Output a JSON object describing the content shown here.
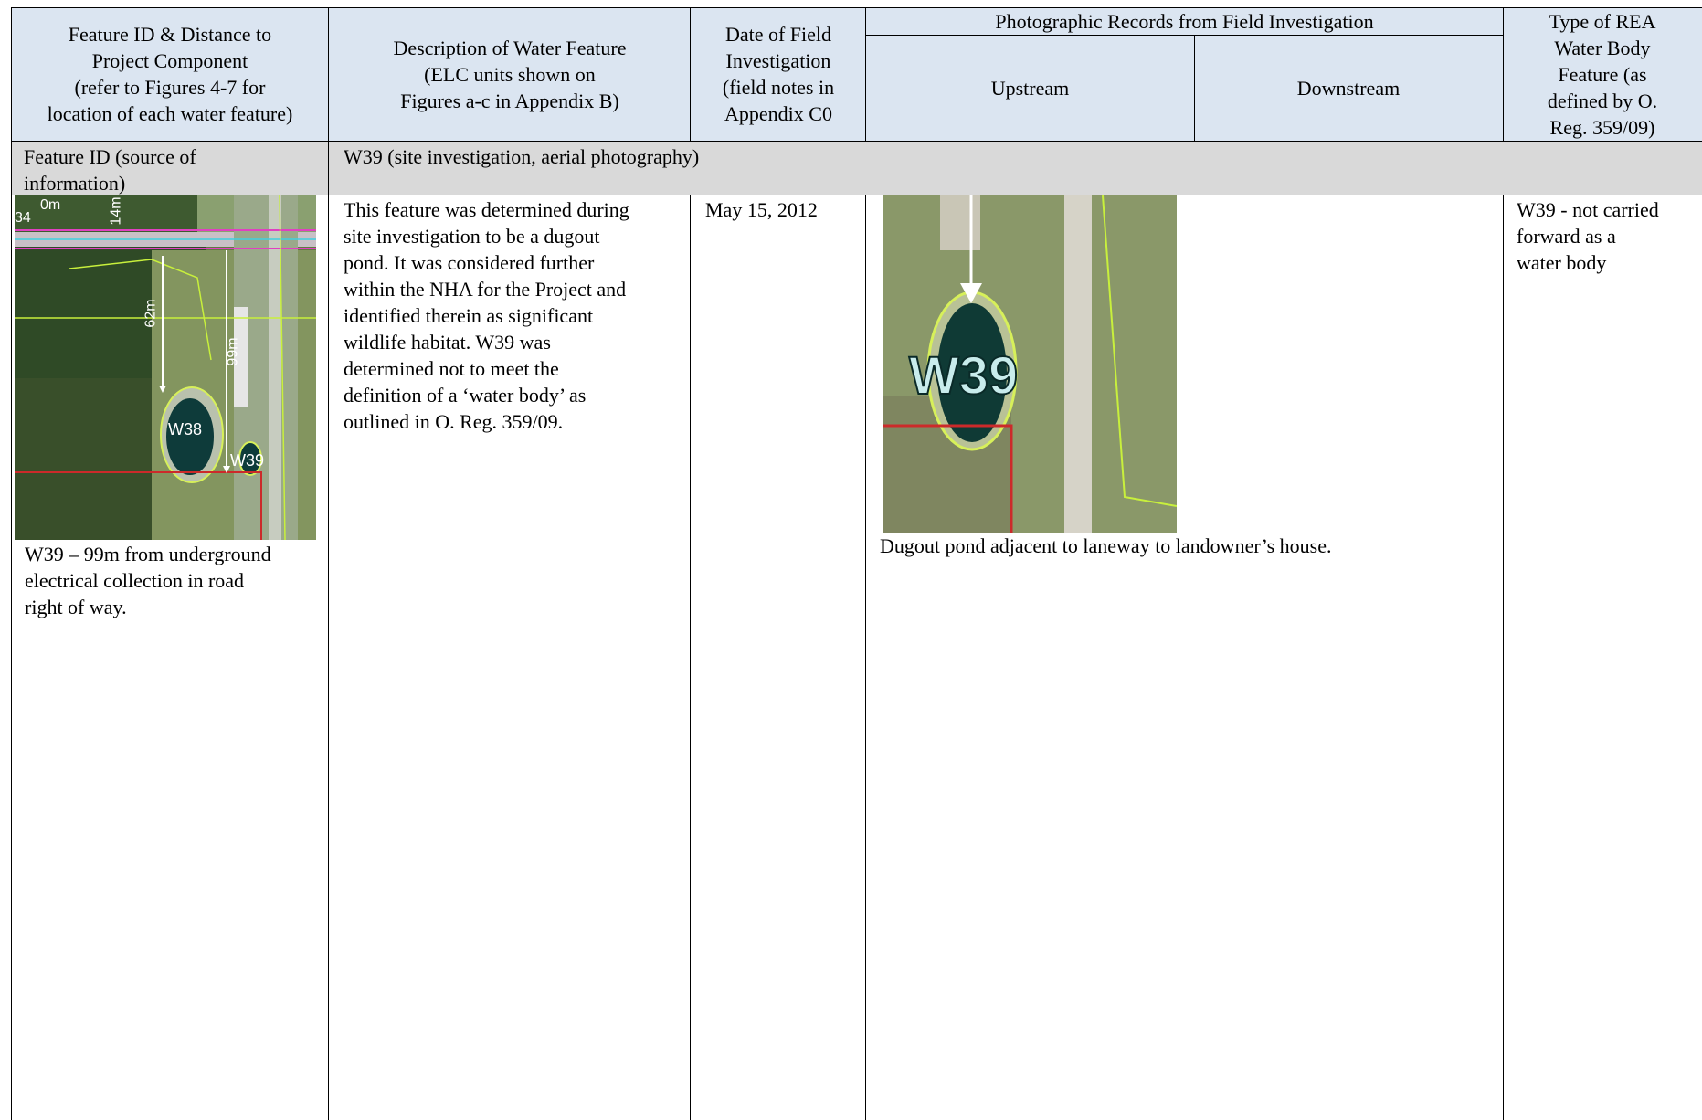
{
  "table": {
    "headers": {
      "feature_id": "Feature ID & Distance to\nProject Component\n(refer to Figures 4-7 for\nlocation of each water feature)",
      "description": "Description of Water Feature\n(ELC units shown on\nFigures a-c in Appendix B)",
      "date": "Date of Field\nInvestigation\n(field notes in\nAppendix C0",
      "photo_group": "Photographic Records from Field Investigation",
      "upstream": "Upstream",
      "downstream": "Downstream",
      "rea_type": "Type of REA\nWater Body\nFeature (as\ndefined by O.\nReg. 359/09)"
    },
    "subheader": {
      "label": "Feature ID (source of\ninformation)",
      "value": "W39 (site investigation,  aerial photography)"
    },
    "row": {
      "map_labels": {
        "d0": "0m",
        "d14": "14m",
        "num34": "34",
        "d62": "62m",
        "d99": "99m",
        "w38": "W38",
        "w39": "W39"
      },
      "feature_caption": "W39 – 99m from underground\nelectrical collection in road\nright of way.",
      "description": "This feature was determined during\nsite investigation to be a dugout\npond.  It was considered further\nwithin the NHA for the Project and\nidentified therein as significant\nwildlife habitat.  W39 was\ndetermined not to meet the\ndefinition of a ‘water body’ as\noutlined in O. Reg. 359/09.",
      "date": "May 15, 2012",
      "photo_label": "W39",
      "photo_caption": "Dugout pond adjacent to laneway to landowner’s house.",
      "rea_type": "W39 - not carried\nforward as a\nwater body"
    }
  },
  "colors": {
    "header_fill": "#dbe5f1",
    "subheader_fill": "#d9d9d9",
    "aerial_green": "#4f6b35",
    "pond": "#0e3b3a",
    "boundary_red": "#cc2a2a",
    "boundary_yellow": "#c8f03c",
    "road_magenta": "#e040c0"
  }
}
